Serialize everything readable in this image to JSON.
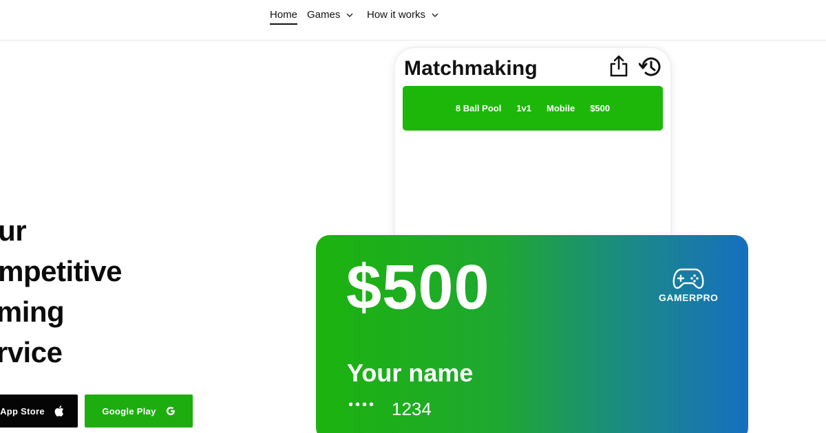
{
  "nav": {
    "items": [
      {
        "label": "Home",
        "active": true
      },
      {
        "label": "Games",
        "has_dropdown": true
      },
      {
        "label": "How it works",
        "has_dropdown": true
      }
    ]
  },
  "hero": {
    "lines": [
      "our",
      "ompetitive",
      "aming",
      "ervice"
    ]
  },
  "store_buttons": {
    "apple_label": "App Store",
    "apple_icon": "apple-icon",
    "google_label": "Google Play",
    "google_icon": "google-g-icon"
  },
  "matchmaking": {
    "title": "Matchmaking",
    "icons": [
      "share-icon",
      "history-icon"
    ],
    "match": {
      "game": "8 Ball Pool",
      "mode": "1v1",
      "platform": "Mobile",
      "stake": "$500"
    }
  },
  "card": {
    "amount": "$500",
    "brand": "GAMERPRO",
    "brand_icon": "gamepad-icon",
    "name": "Your name",
    "dots": "••••",
    "last_digits": "1234"
  },
  "colors": {
    "accent_green": "#1db709",
    "button_green": "#1dad0f",
    "gradient_blue": "#166fc0",
    "text_dark": "#111111"
  }
}
